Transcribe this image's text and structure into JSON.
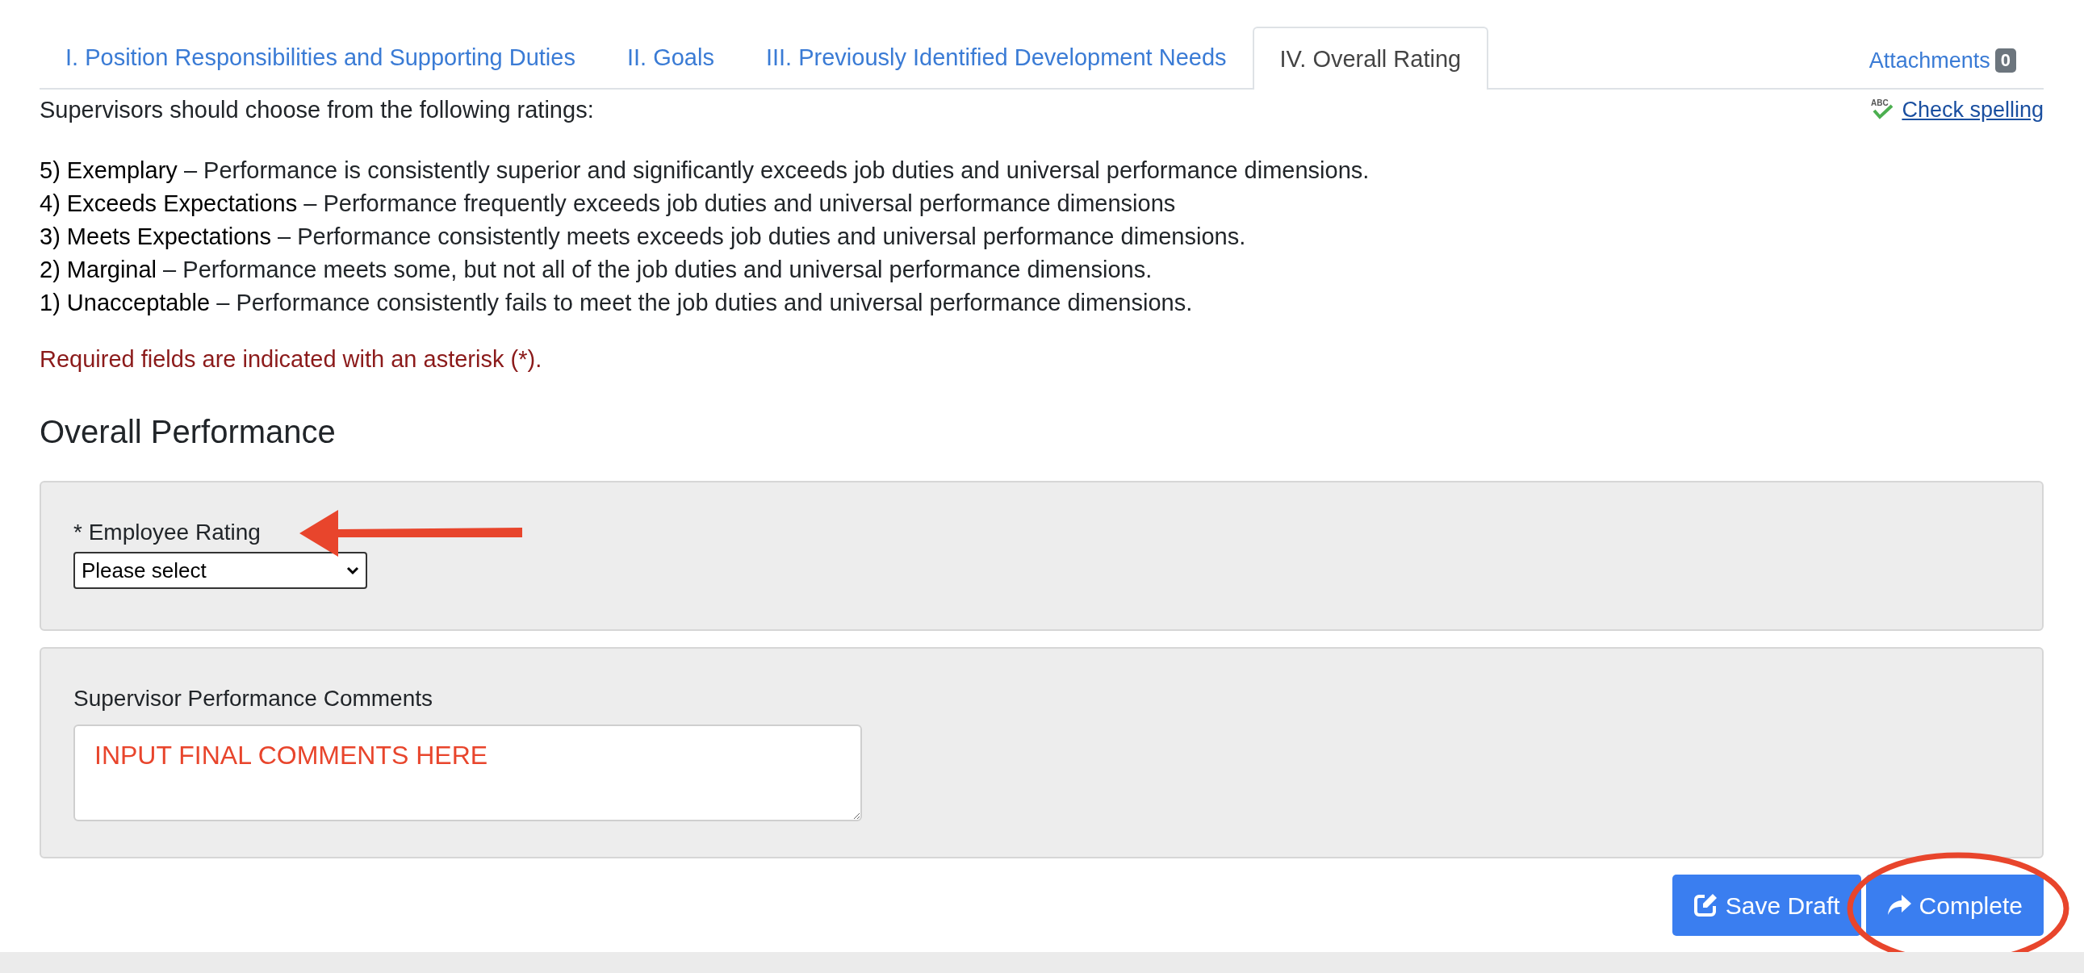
{
  "tabs": [
    {
      "label": "I. Position Responsibilities and Supporting Duties",
      "selected": false
    },
    {
      "label": "II. Goals",
      "selected": false
    },
    {
      "label": "III. Previously Identified Development Needs",
      "selected": false
    },
    {
      "label": "IV. Overall Rating",
      "selected": true
    }
  ],
  "attachments": {
    "label": "Attachments",
    "count": "0"
  },
  "intro": "Supervisors should choose from the following ratings:",
  "spellcheck": {
    "icon_text": "ABC",
    "label": "Check spelling"
  },
  "ratings": [
    "**5) Exemplary** – Performance is consistently superior and significantly exceeds job duties and universal performance dimensions.",
    "**4) Exceeds Expectations** – Performance frequently exceeds job duties and universal performance dimensions",
    "**3) Meets Expectations** – Performance consistently meets exceeds job duties and universal performance dimensions.",
    "**2) Marginal** – Performance meets some, but not all of the job duties and universal performance dimensions.",
    "**1) Unacceptable** – Performance consistently fails to meet the job duties and universal performance dimensions."
  ],
  "required_note": "Required fields are indicated with an asterisk (*).",
  "section_title": "Overall Performance",
  "employee_rating": {
    "label": "* Employee Rating",
    "value": "Please select"
  },
  "comments": {
    "label": "Supervisor Performance Comments",
    "value": "INPUT FINAL COMMENTS HERE"
  },
  "buttons": [
    {
      "kind": "save",
      "label": "Save Draft"
    },
    {
      "kind": "complete",
      "label": "Complete"
    }
  ]
}
